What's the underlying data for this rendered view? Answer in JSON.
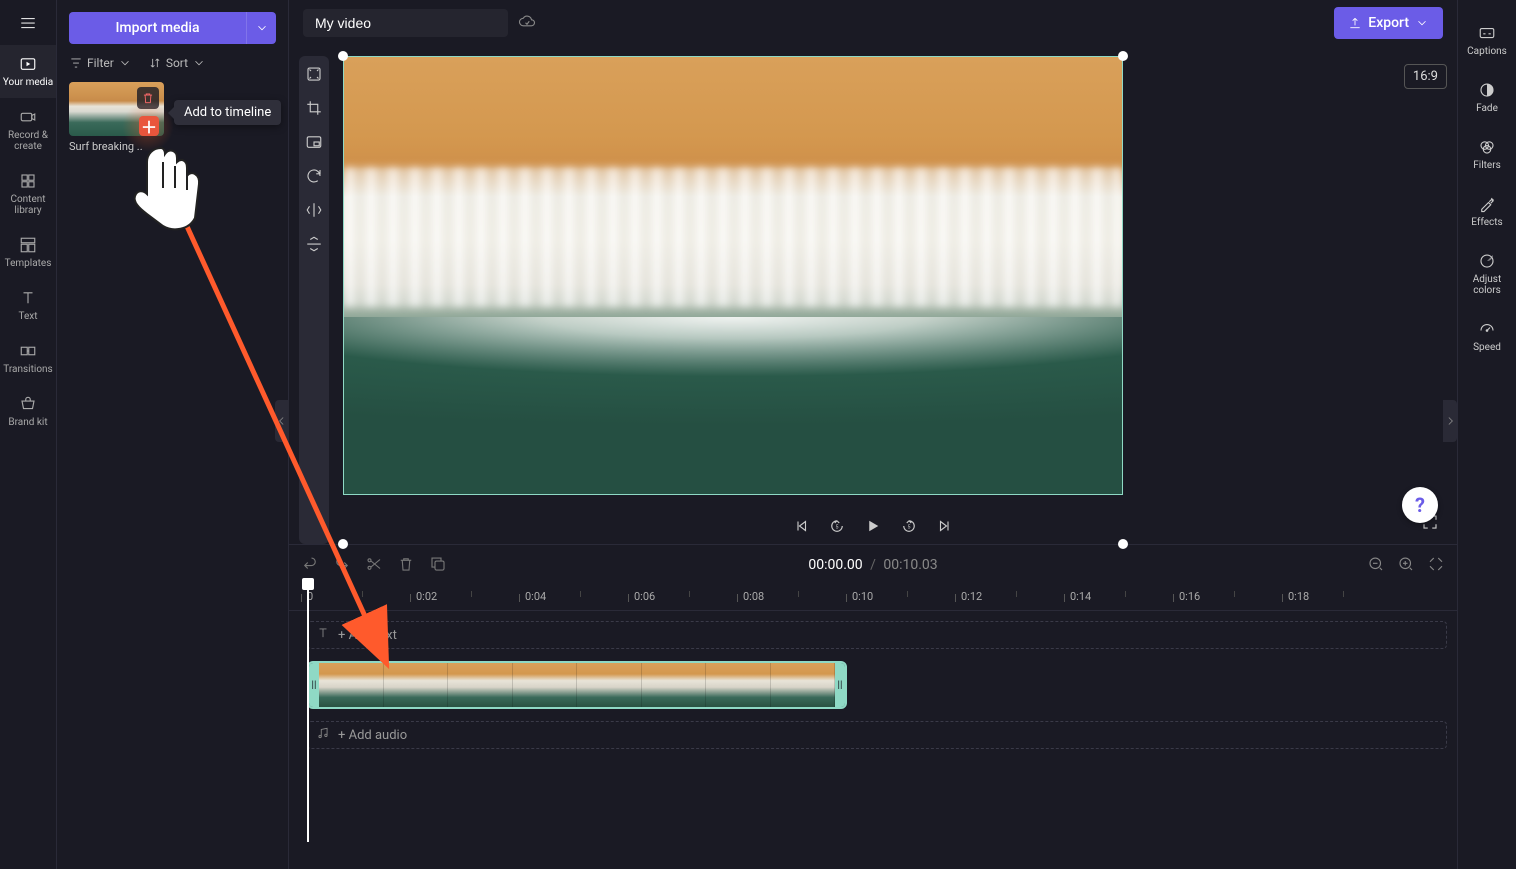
{
  "left_rail": {
    "items": [
      {
        "label": "Your media"
      },
      {
        "label": "Record & create"
      },
      {
        "label": "Content library"
      },
      {
        "label": "Templates"
      },
      {
        "label": "Text"
      },
      {
        "label": "Transitions"
      },
      {
        "label": "Brand kit"
      }
    ]
  },
  "media_panel": {
    "import_label": "Import media",
    "filter_label": "Filter",
    "sort_label": "Sort",
    "clip_name": "Surf breaking ..",
    "tooltip": "Add to timeline"
  },
  "top_bar": {
    "project_title": "My video",
    "export_label": "Export",
    "aspect": "16:9"
  },
  "player": {
    "current_time": "00:00.00",
    "separator": "/",
    "total_time": "00:10.03"
  },
  "ruler": {
    "ticks": [
      "0",
      "0:02",
      "0:04",
      "0:06",
      "0:08",
      "0:10",
      "0:12",
      "0:14",
      "0:16",
      "0:18"
    ]
  },
  "tracks": {
    "text_label": "+ Add text",
    "audio_label": "+ Add audio"
  },
  "right_rail": {
    "items": [
      {
        "label": "Captions"
      },
      {
        "label": "Fade"
      },
      {
        "label": "Filters"
      },
      {
        "label": "Effects"
      },
      {
        "label": "Adjust colors"
      },
      {
        "label": "Speed"
      }
    ]
  },
  "help": "?"
}
